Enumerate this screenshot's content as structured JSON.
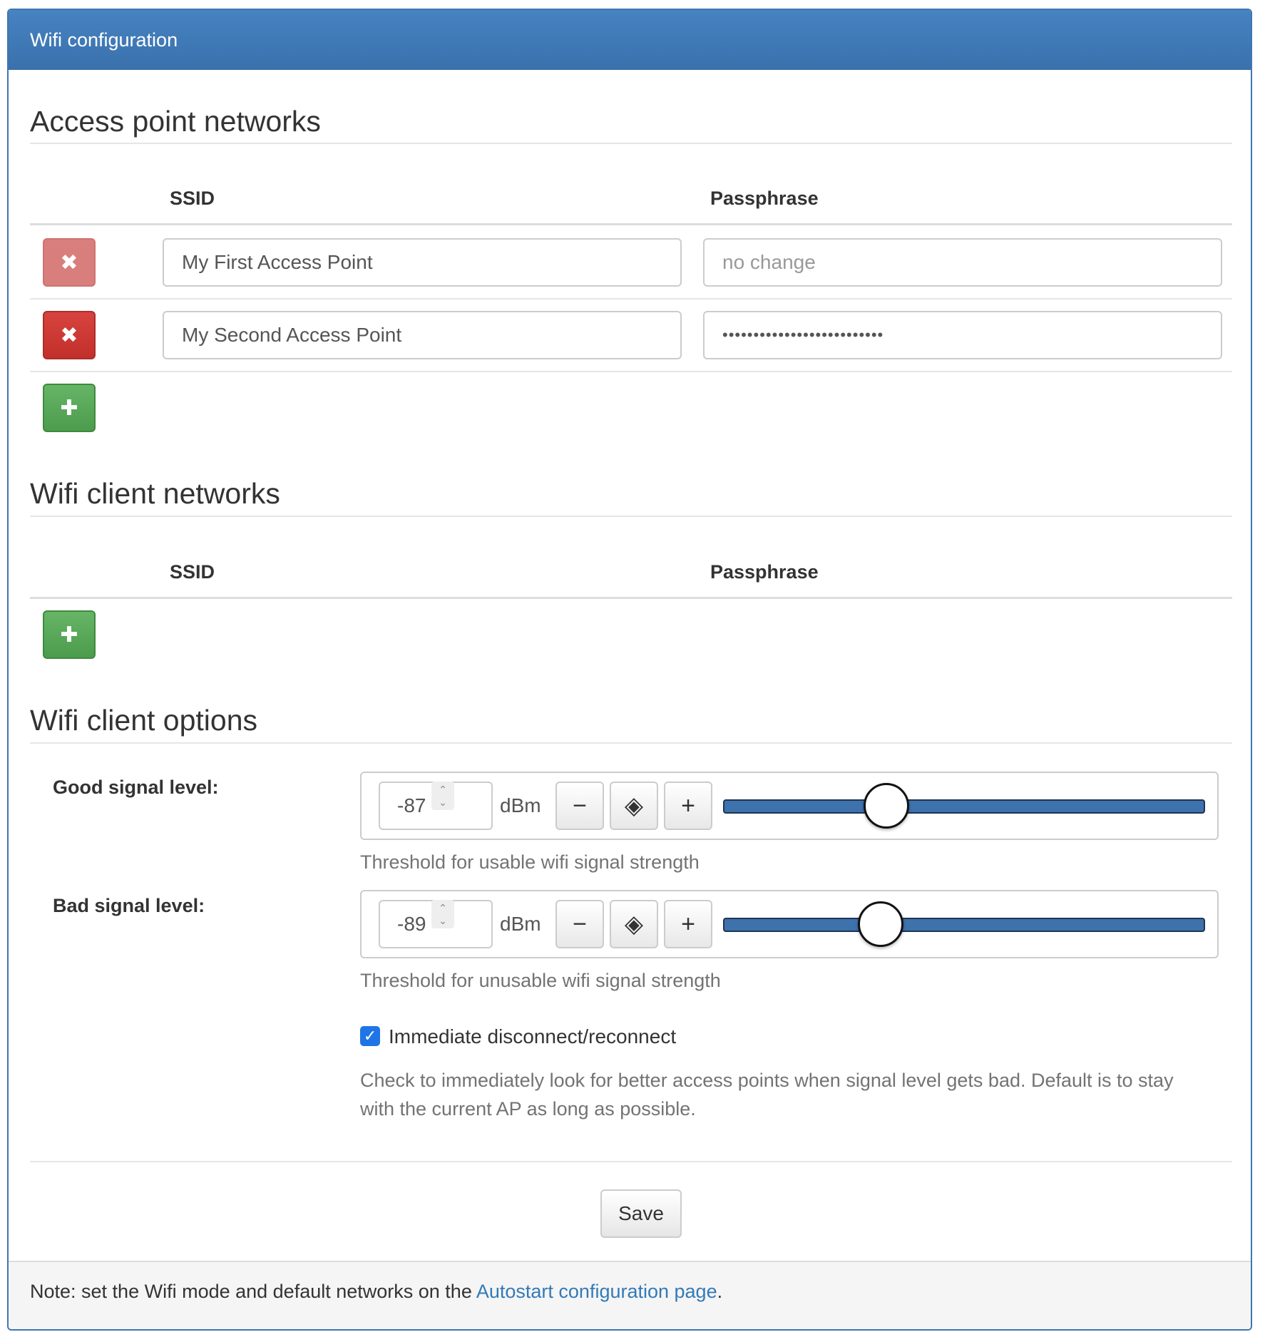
{
  "panel": {
    "title": "Wifi configuration"
  },
  "access_point": {
    "heading": "Access point networks",
    "col_ssid": "SSID",
    "col_pass": "Passphrase",
    "rows": [
      {
        "ssid": "My First Access Point",
        "pass_placeholder": "no change",
        "pass_value": ""
      },
      {
        "ssid": "My Second Access Point",
        "pass_placeholder": "",
        "pass_value": "••••••••••••••••••••••••••"
      }
    ],
    "remove_icon": "✖",
    "add_icon": "✚"
  },
  "client": {
    "heading": "Wifi client networks",
    "col_ssid": "SSID",
    "col_pass": "Passphrase",
    "add_icon": "✚"
  },
  "options": {
    "heading": "Wifi client options",
    "good": {
      "label": "Good signal level:",
      "value": "-87",
      "unit": "dBm",
      "help": "Threshold for usable wifi signal strength",
      "slider_fraction": 0.338
    },
    "bad": {
      "label": "Bad signal level:",
      "value": "-89",
      "unit": "dBm",
      "help": "Threshold for unusable wifi signal strength",
      "slider_fraction": 0.326
    },
    "minus": "−",
    "reset": "◈",
    "plus": "+",
    "immediate": {
      "checked": true,
      "label": "Immediate disconnect/reconnect",
      "help_line1": "Check to immediately look for better access points when signal level gets bad. Default is to stay",
      "help_line2": "with the current AP as long as possible."
    }
  },
  "save_label": "Save",
  "footer": {
    "text": "Note: set the Wifi mode and default networks on the ",
    "link": "Autostart configuration page",
    "end": "."
  }
}
